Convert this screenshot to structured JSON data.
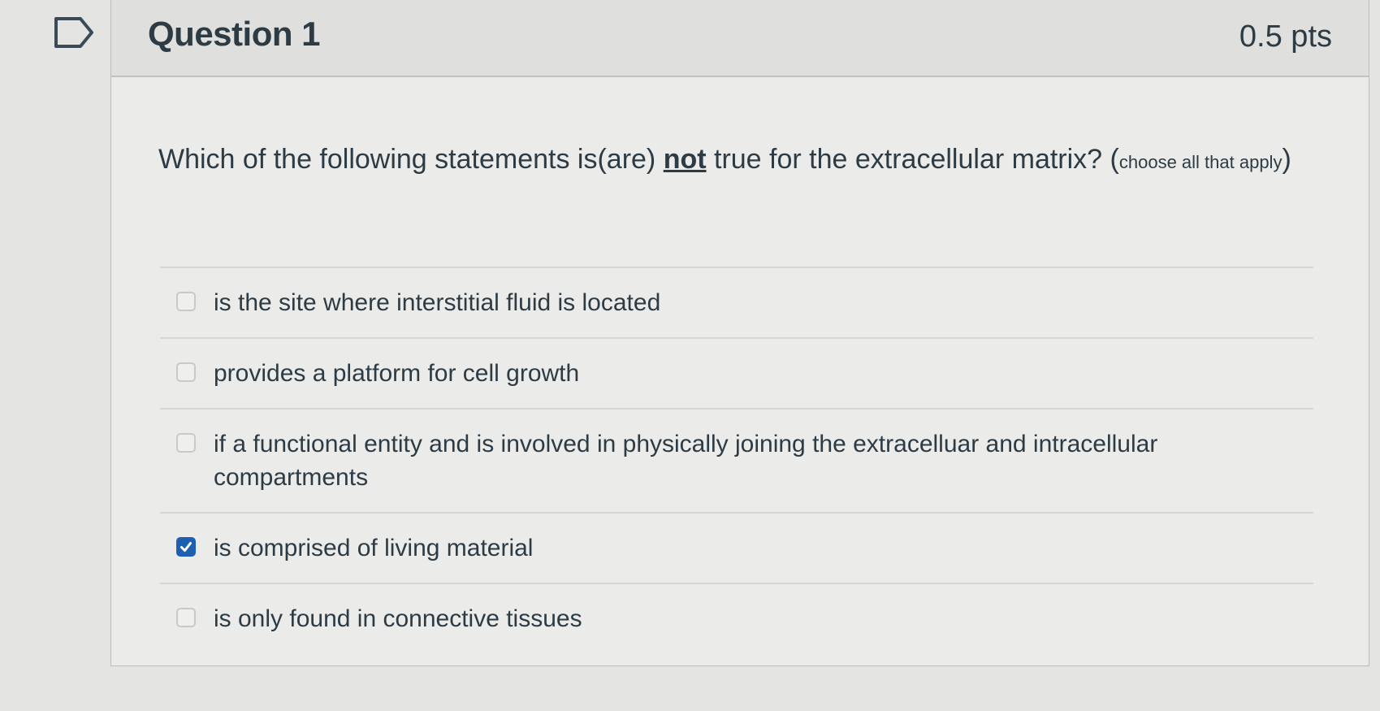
{
  "question": {
    "title": "Question 1",
    "points": "0.5 pts",
    "text_before": "Which of the following statements is(are) ",
    "text_emphasis": "not",
    "text_after": " true for the extracellular matrix? (",
    "text_note": "choose all that apply",
    "text_close": ")"
  },
  "answers": [
    {
      "label": "is the site where interstitial fluid is located",
      "checked": false
    },
    {
      "label": "provides a platform for cell growth",
      "checked": false
    },
    {
      "label": "if a functional entity and is involved in physically joining the extracelluar and intracellular compartments",
      "checked": false
    },
    {
      "label": "is comprised of living material",
      "checked": true
    },
    {
      "label": "is only found in connective tissues",
      "checked": false
    }
  ],
  "colors": {
    "checkbox_checked": "#1f5fb0",
    "text": "#2d3b45"
  },
  "icons": {
    "flag": "bookmark-flag-icon",
    "check": "checkmark-icon"
  }
}
